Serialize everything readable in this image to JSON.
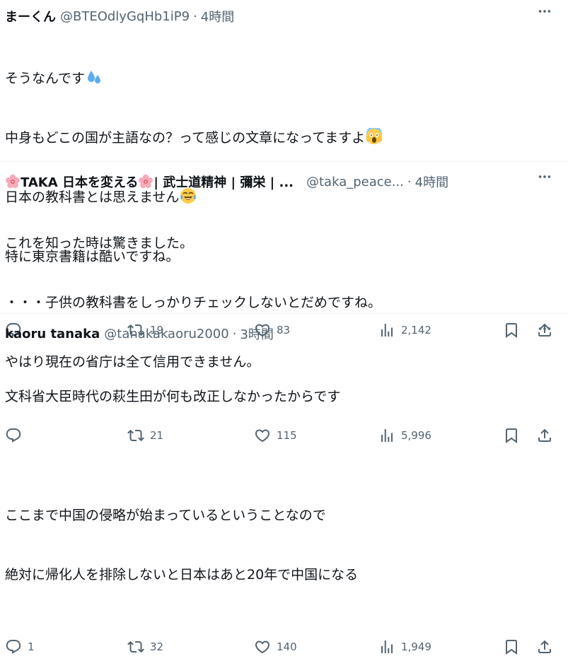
{
  "tweets": [
    {
      "display_name": "まーくん",
      "handle": "@BTEOdlyGqHb1iP9",
      "separator": "·",
      "time": "4時間",
      "lines": [
        "そうなんです",
        "中身もどこの国が主語なの？って感じの文章になってますよ",
        "日本の教科書とは思えません",
        "特に東京書籍は酷いですね。"
      ],
      "emojis": [
        "sweat-droplets",
        "screaming-face",
        "tears-of-joy-face"
      ],
      "reply_count": "",
      "retweet_count": "19",
      "like_count": "83",
      "view_count": "2,142"
    },
    {
      "display_name": "TAKA 日本を変える",
      "display_name_suffix": " | 武士道精神 | 彌栄 | ...",
      "handle": "@taka_peace...",
      "separator": "·",
      "time": "4時間",
      "lines": [
        "これを知った時は驚きました。",
        "・・・子供の教科書をしっかりチェックしないとだめですね。",
        "やはり現在の省庁は全て信用できません。"
      ],
      "emojis": [
        "cherry-blossom",
        "cherry-blossom"
      ],
      "reply_count": "",
      "retweet_count": "21",
      "like_count": "115",
      "view_count": "5,996"
    },
    {
      "display_name": "kaoru tanaka",
      "handle": "@tanakakaoru2000",
      "separator": "·",
      "time": "3時間",
      "lines": [
        "文科省大臣時代の萩生田が何も改正しなかったからです",
        "",
        "ここまで中国の侵略が始まっているということなので",
        "絶対に帰化人を排除しないと日本はあと20年で中国になる"
      ],
      "reply_count": "1",
      "retweet_count": "32",
      "like_count": "140",
      "view_count": "1,949"
    }
  ],
  "colors": {
    "text_primary": "#0f1419",
    "text_secondary": "#536471",
    "divider": "#eff3f4"
  }
}
